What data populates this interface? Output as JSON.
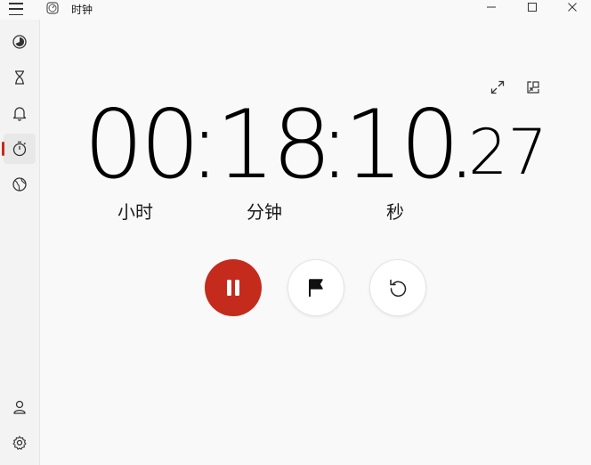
{
  "app": {
    "title": "时钟"
  },
  "window_controls": [
    "minimize",
    "maximize",
    "close"
  ],
  "sidebar": {
    "items": [
      {
        "icon": "focus-icon"
      },
      {
        "icon": "timer-hourglass-icon"
      },
      {
        "icon": "alarm-bell-icon"
      },
      {
        "icon": "stopwatch-icon",
        "active": true
      },
      {
        "icon": "world-clock-icon"
      }
    ],
    "bottom_items": [
      {
        "icon": "account-icon"
      },
      {
        "icon": "settings-gear-icon"
      }
    ]
  },
  "stopwatch": {
    "hours": "00",
    "minutes": "18",
    "seconds": "10",
    "sep1": ":",
    "sep2": ":",
    "dot": ".",
    "centiseconds": "27",
    "label_hours": "小时",
    "label_minutes": "分钟",
    "label_seconds": "秒"
  },
  "tools": [
    "expand-icon",
    "compact-overlay-icon"
  ],
  "controls": [
    "pause-icon",
    "lap-flag-icon",
    "reset-icon"
  ],
  "colors": {
    "accent": "#c42b1c",
    "background": "#f9f9f9",
    "sidebar": "#f3f3f3"
  }
}
